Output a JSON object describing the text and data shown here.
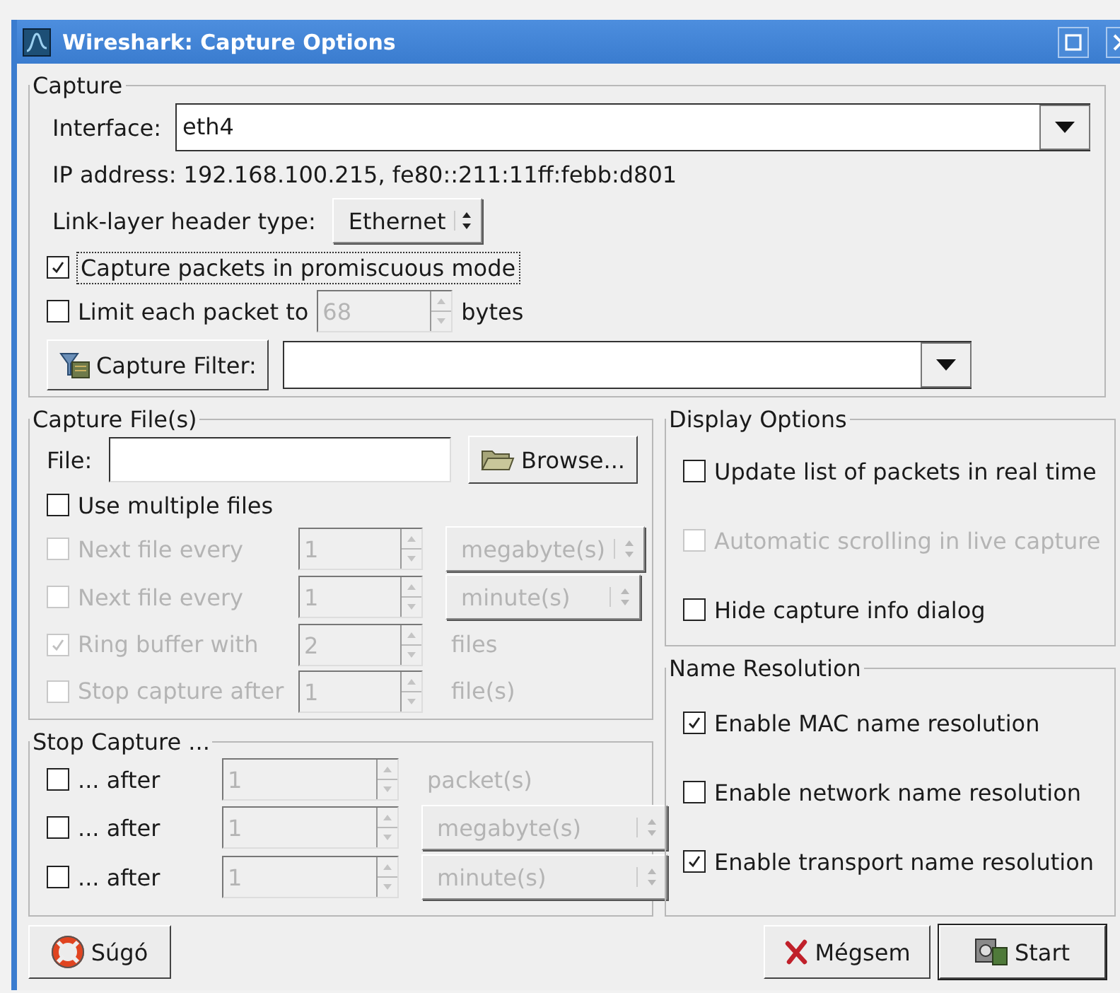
{
  "window": {
    "title": "Wireshark: Capture Options"
  },
  "capture": {
    "title": "Capture",
    "interface": {
      "label": "Interface:",
      "value": "eth4"
    },
    "ip_address": "IP address: 192.168.100.215, fe80::211:11ff:febb:d801",
    "link_layer": {
      "label": "Link-layer header type:",
      "value": "Ethernet"
    },
    "promiscuous": {
      "label": "Capture packets in promiscuous mode",
      "checked": true,
      "focused": true
    },
    "limit": {
      "label": "Limit each packet to",
      "checked": false,
      "value": "68",
      "unit": "bytes",
      "input_disabled": true
    },
    "filter": {
      "button": "Capture Filter:"
    }
  },
  "capture_files": {
    "title": "Capture File(s)",
    "file_label": "File:",
    "browse": "Browse...",
    "multiple": {
      "label": "Use multiple files",
      "checked": false
    },
    "rows": [
      {
        "label": "Next file every",
        "checked": false,
        "disabled": true,
        "value": "1",
        "unit": "megabyte(s)",
        "kind": "select"
      },
      {
        "label": "Next file every",
        "checked": false,
        "disabled": true,
        "value": "1",
        "unit": "minute(s)",
        "kind": "select"
      },
      {
        "label": "Ring buffer with",
        "checked": true,
        "disabled": true,
        "value": "2",
        "unit": "files",
        "kind": "text"
      },
      {
        "label": "Stop capture after",
        "checked": false,
        "disabled": true,
        "value": "1",
        "unit": "file(s)",
        "kind": "text"
      }
    ]
  },
  "stop_capture": {
    "title": "Stop Capture ...",
    "rows": [
      {
        "label": "... after",
        "checked": false,
        "disabled": false,
        "input_disabled": true,
        "value": "1",
        "unit": "packet(s)",
        "kind": "text"
      },
      {
        "label": "... after",
        "checked": false,
        "disabled": false,
        "input_disabled": true,
        "value": "1",
        "unit": "megabyte(s)",
        "kind": "select"
      },
      {
        "label": "... after",
        "checked": false,
        "disabled": false,
        "input_disabled": true,
        "value": "1",
        "unit": "minute(s)",
        "kind": "select"
      }
    ]
  },
  "display_options": {
    "title": "Display Options",
    "options": [
      {
        "label": "Update list of packets in real time",
        "checked": false,
        "disabled": false
      },
      {
        "label": "Automatic scrolling in live capture",
        "checked": false,
        "disabled": true
      },
      {
        "label": "Hide capture info dialog",
        "checked": false,
        "disabled": false
      }
    ]
  },
  "name_resolution": {
    "title": "Name Resolution",
    "options": [
      {
        "label": "Enable MAC name resolution",
        "checked": true,
        "disabled": false
      },
      {
        "label": "Enable network name resolution",
        "checked": false,
        "disabled": false
      },
      {
        "label": "Enable transport name resolution",
        "checked": true,
        "disabled": false
      }
    ]
  },
  "buttons": [
    {
      "kind": "help",
      "label": "Súgó",
      "default": false
    },
    {
      "kind": "cancel",
      "label": "Mégsem",
      "default": false
    },
    {
      "kind": "start",
      "label": "Start",
      "default": true
    }
  ]
}
